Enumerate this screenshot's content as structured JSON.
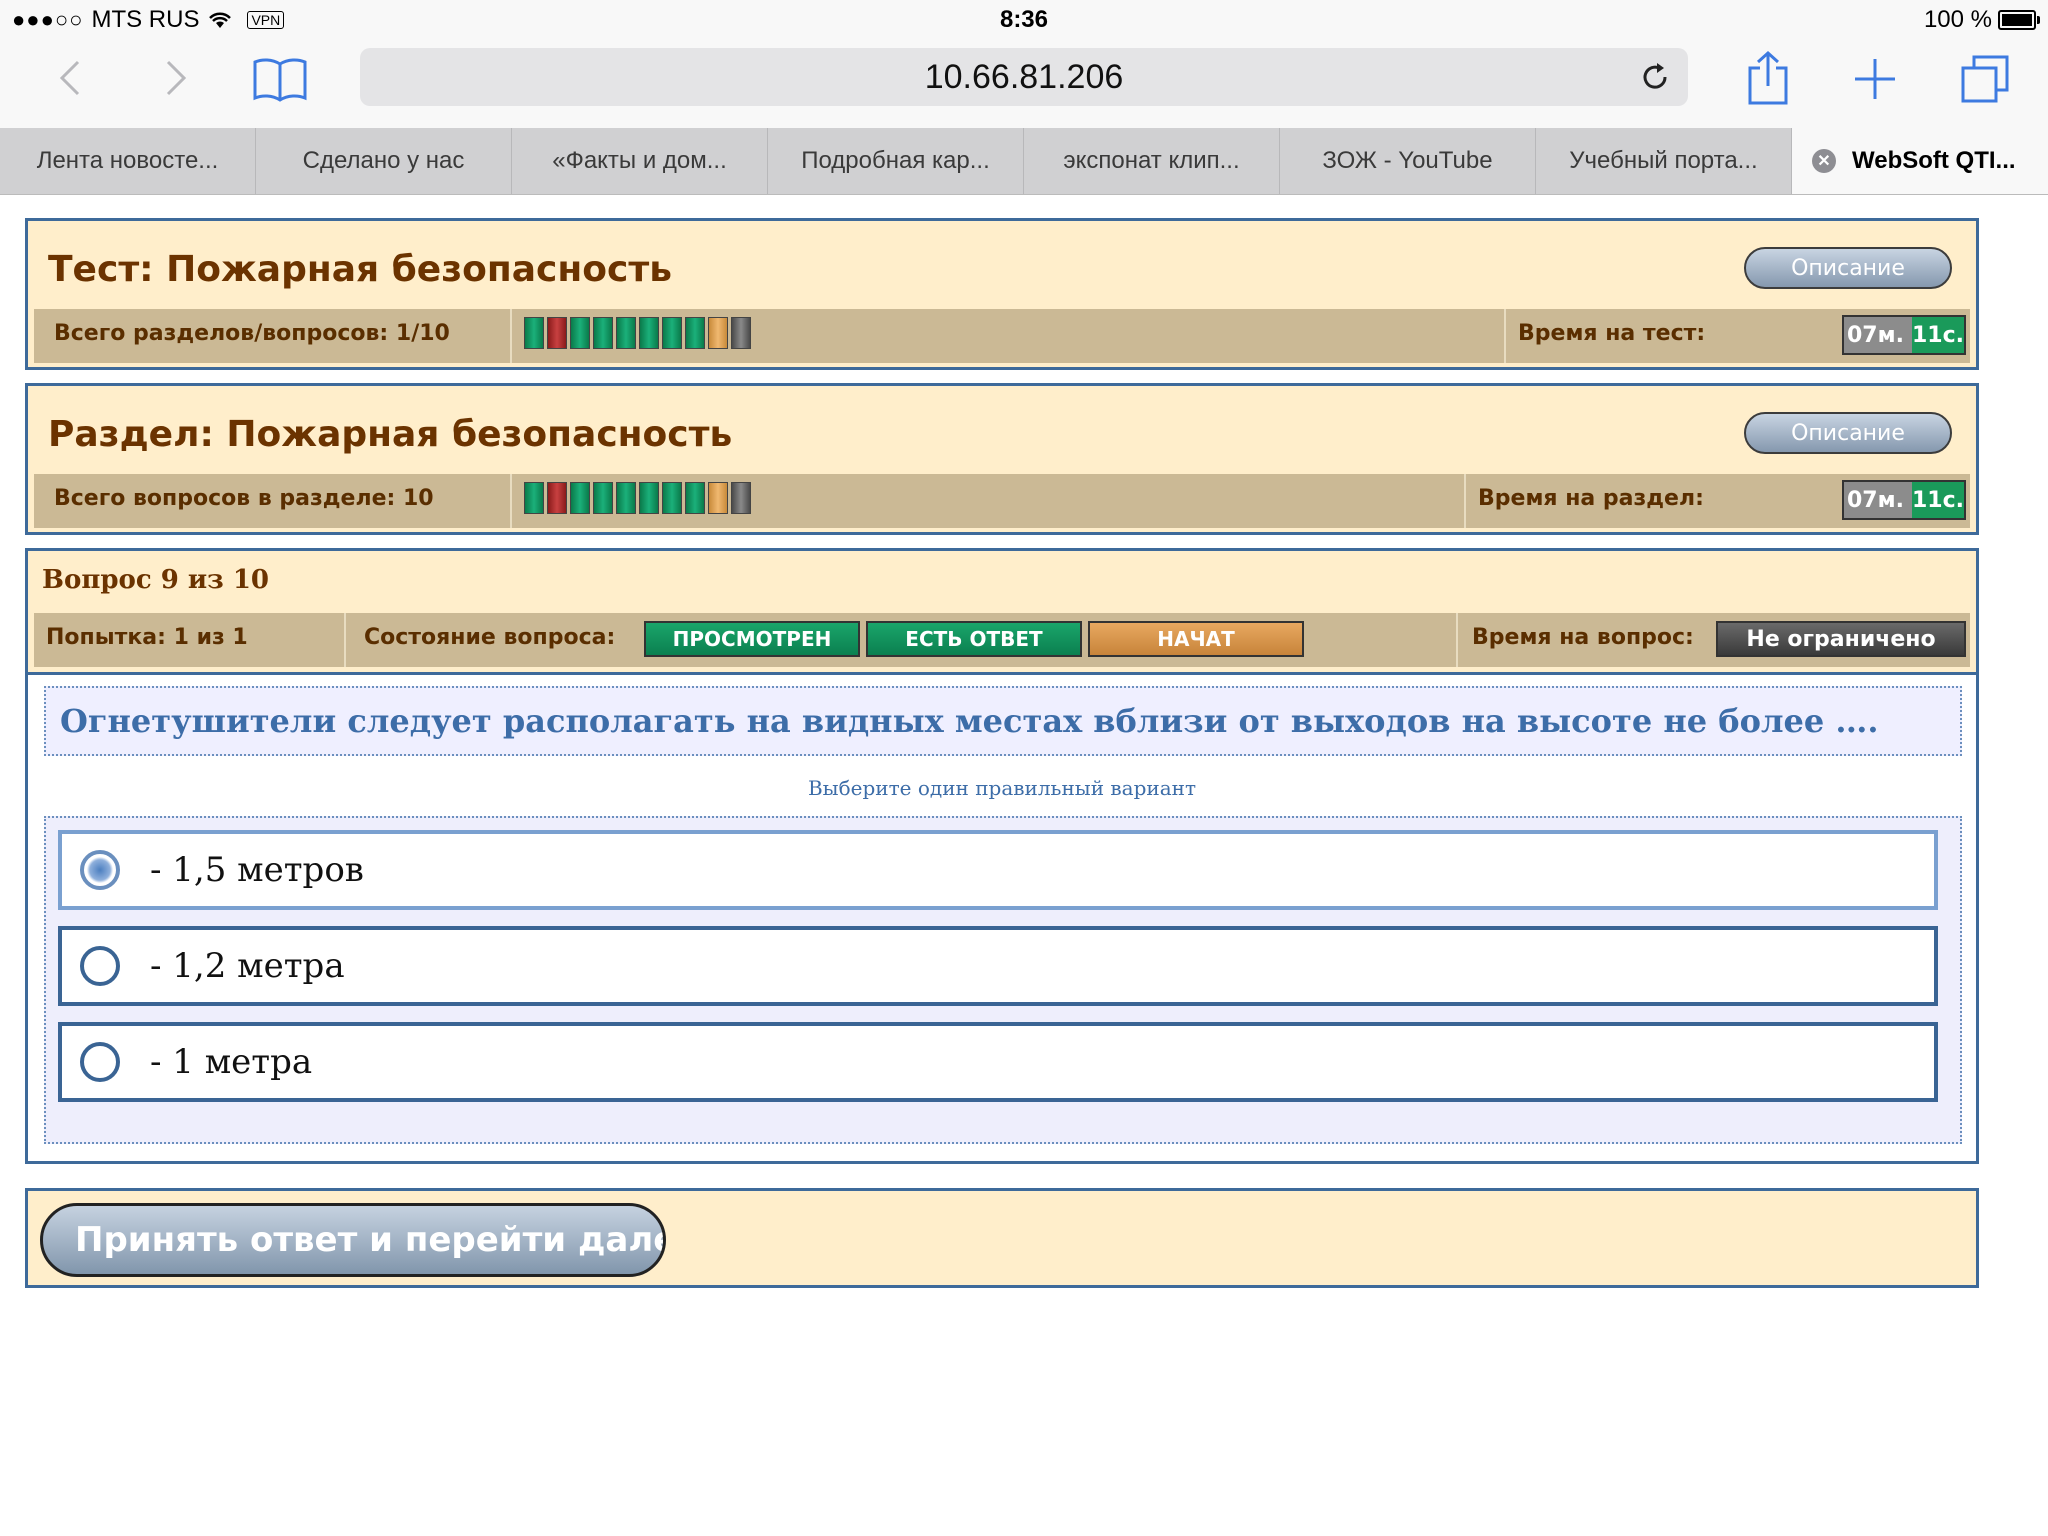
{
  "status_bar": {
    "signal": "●●●○○",
    "carrier": "MTS RUS",
    "vpn": "VPN",
    "time": "8:36",
    "battery": "100 %"
  },
  "browser": {
    "url": "10.66.81.206",
    "tabs": [
      {
        "label": "Лента новосте..."
      },
      {
        "label": "Сделано у нас"
      },
      {
        "label": "«Факты и дом..."
      },
      {
        "label": "Подробная кар..."
      },
      {
        "label": "экспонат клип..."
      },
      {
        "label": "ЗОЖ - YouTube"
      },
      {
        "label": "Учебный порта..."
      },
      {
        "label": "WebSoft QTI..."
      }
    ],
    "icons": [
      "back-icon",
      "forward-icon",
      "bookmarks-icon",
      "reload-icon",
      "share-icon",
      "new-tab-icon",
      "tabs-icon"
    ]
  },
  "test": {
    "title": "Тест: Пожарная безопасность",
    "desc_button": "Описание",
    "count_label": "Всего разделов/вопросов: 1/10",
    "time_label": "Время на тест:",
    "timer_min": "07м.",
    "timer_sec": "11с."
  },
  "section": {
    "title": "Раздел: Пожарная безопасность",
    "desc_button": "Описание",
    "count_label": "Всего вопросов в разделе: 10",
    "time_label": "Время на раздел:",
    "timer_min": "07м.",
    "timer_sec": "11с."
  },
  "progress_cells": [
    "green",
    "red",
    "green",
    "green",
    "green",
    "green",
    "green",
    "green",
    "orange",
    "gray"
  ],
  "question": {
    "header": "Вопрос 9 из 10",
    "attempt": "Попытка: 1 из 1",
    "state_label": "Состояние вопроса:",
    "states": [
      "ПРОСМОТРЕН",
      "ЕСТЬ ОТВЕТ",
      "НАЧАТ"
    ],
    "time_label": "Время на вопрос:",
    "time_value": "Не ограничено",
    "text": "Огнетушители следует располагать на видных местах вблизи от выходов на высоте не более ….",
    "hint": "Выберите один правильный вариант",
    "options": [
      {
        "label": "- 1,5 метров",
        "selected": true
      },
      {
        "label": "- 1,2 метра",
        "selected": false
      },
      {
        "label": "- 1 метра",
        "selected": false
      }
    ]
  },
  "submit_button": "Принять ответ и перейти дале",
  "colors": {
    "panel_bg": "#ffeecb",
    "infobar_bg": "#cbb995",
    "panel_border": "#3e6a9a",
    "title_text": "#6b3300",
    "question_text": "#3d6da8",
    "browser_accent": "#3d7ae0"
  }
}
